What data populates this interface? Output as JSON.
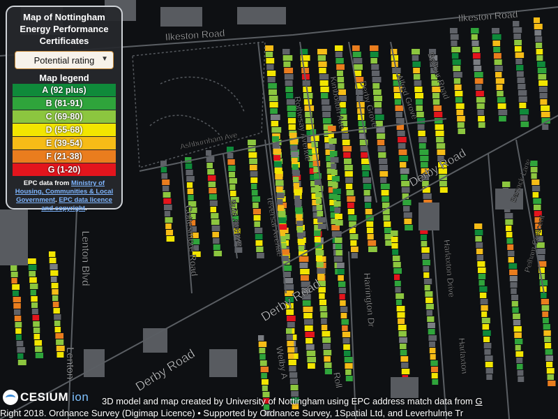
{
  "panel": {
    "title": "Map of Nottingham Energy Performance Certificates",
    "select_value": "Potential rating",
    "legend_title": "Map legend",
    "legend": [
      {
        "label": "A (92 plus)",
        "color": "#0f8a3a"
      },
      {
        "label": "B (81-91)",
        "color": "#2fa43b"
      },
      {
        "label": "C (69-80)",
        "color": "#8cc63f"
      },
      {
        "label": "D (55-68)",
        "color": "#f2e500"
      },
      {
        "label": "E (39-54)",
        "color": "#f6bc17"
      },
      {
        "label": "F (21-38)",
        "color": "#ea7d1e"
      },
      {
        "label": "G (1-20)",
        "color": "#e3151d"
      }
    ],
    "credit_prefix": "EPC data from",
    "credit_link1": "Ministry of Housing, Communities & Local Government",
    "credit_sep": ".",
    "credit_link2": "EPC data licence and copyright",
    "credit_end": "."
  },
  "roads": [
    {
      "label": "Ilkeston Road"
    },
    {
      "label": "Ilkeston Road"
    },
    {
      "label": "Ashburnham Ave"
    },
    {
      "label": "Rothesay Avenue"
    },
    {
      "label": "Kimbolton Ave"
    },
    {
      "label": "Derby Grove"
    },
    {
      "label": "Alfred Grove"
    },
    {
      "label": "Balfour Road"
    },
    {
      "label": "Cottesmore Road"
    },
    {
      "label": "Bute Avenue"
    },
    {
      "label": "Teversal Avenue"
    },
    {
      "label": "Derby Road"
    },
    {
      "label": "Derby Road"
    },
    {
      "label": "Derby Road"
    },
    {
      "label": "Harrington Dr"
    },
    {
      "label": "Harlaxton Drive"
    },
    {
      "label": "Harlaxton"
    },
    {
      "label": "Lenton Blvd"
    },
    {
      "label": "Lenton"
    },
    {
      "label": "Barrack Lane"
    },
    {
      "label": "Pelham Crescent"
    },
    {
      "label": "Welby A"
    },
    {
      "label": "Roll"
    }
  ],
  "footer": {
    "brand": "CESIUM",
    "brand_suffix": "ion",
    "line1": "3D model and map created by University of Nottingham using EPC address match data from",
    "line1_link": "G",
    "line2_prefix": "Right 2018.",
    "line2": "Ordnance Survey (Digimap Licence) • Supported by Ordnance Survey, 1Spatial Ltd, and Leverhulme Tr"
  }
}
